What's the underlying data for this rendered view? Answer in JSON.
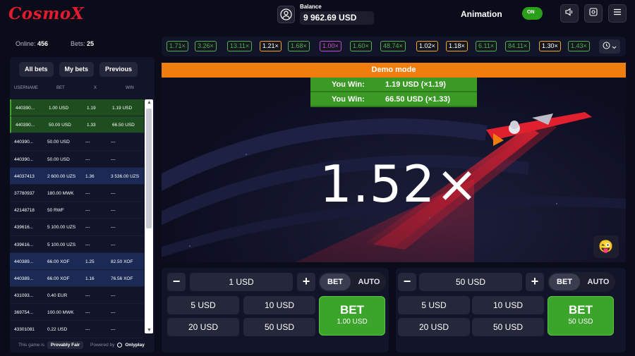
{
  "header": {
    "logo": "CosmoX",
    "balance_label": "Balance",
    "balance_value": "9 962.69 USD",
    "animation_label": "Animation",
    "animation_toggle": "ON",
    "colors": {
      "brand_red": "#e21b2f",
      "toggle_green": "#2aa01a"
    },
    "icons": [
      "user-icon",
      "speaker-icon",
      "settings-icon",
      "menu-icon"
    ]
  },
  "stats": {
    "online_label": "Online:",
    "online_value": "456",
    "bets_label": "Bets:",
    "bets_value": "25"
  },
  "left_tabs": [
    "All bets",
    "My bets",
    "Previous"
  ],
  "table": {
    "headers": [
      "USERNAME",
      "BET",
      "X",
      "WIN"
    ],
    "rows": [
      {
        "user": "440390...",
        "bet": "1.00 USD",
        "x": "1.19",
        "win": "1.19 USD",
        "style": "win"
      },
      {
        "user": "440390...",
        "bet": "50.00 USD",
        "x": "1.33",
        "win": "66.50 USD",
        "style": "win"
      },
      {
        "user": "440390...",
        "bet": "50.00 USD",
        "x": "---",
        "win": "---",
        "style": ""
      },
      {
        "user": "440390...",
        "bet": "50.00 USD",
        "x": "---",
        "win": "---",
        "style": ""
      },
      {
        "user": "44037413",
        "bet": "2 600.00 UZS",
        "x": "1.36",
        "win": "3 536.00 UZS",
        "style": "blue"
      },
      {
        "user": "37780937",
        "bet": "180.00 MWK",
        "x": "---",
        "win": "---",
        "style": ""
      },
      {
        "user": "42148718",
        "bet": "50 RWF",
        "x": "---",
        "win": "---",
        "style": ""
      },
      {
        "user": "439616...",
        "bet": "5 100.00 UZS",
        "x": "---",
        "win": "---",
        "style": ""
      },
      {
        "user": "439616...",
        "bet": "5 100.00 UZS",
        "x": "---",
        "win": "---",
        "style": ""
      },
      {
        "user": "440389...",
        "bet": "66.00 XOF",
        "x": "1.25",
        "win": "82.50 XOF",
        "style": "blue"
      },
      {
        "user": "440389...",
        "bet": "66.00 XOF",
        "x": "1.16",
        "win": "76.56 XOF",
        "style": "blue"
      },
      {
        "user": "431093...",
        "bet": "0.40 EUR",
        "x": "---",
        "win": "---",
        "style": ""
      },
      {
        "user": "369754...",
        "bet": "100.00 MWK",
        "x": "---",
        "win": "---",
        "style": ""
      },
      {
        "user": "43301081",
        "bet": "0.22 USD",
        "x": "---",
        "win": "---",
        "style": ""
      }
    ]
  },
  "footer": {
    "text1": "This game is",
    "provably_fair": "Provably Fair",
    "powered_by": "Powered by",
    "provider": "Onlyplay"
  },
  "multipliers": [
    {
      "value": "1.71×",
      "color": "#4caf50"
    },
    {
      "value": "3.26×",
      "color": "#4caf50"
    },
    {
      "value": "13.11×",
      "color": "#4caf50"
    },
    {
      "value": "1.21×",
      "color": "#f5a623"
    },
    {
      "value": "1.68×",
      "color": "#4caf50"
    },
    {
      "value": "1.00×",
      "color": "#c04ad9"
    },
    {
      "value": "1.60×",
      "color": "#4caf50"
    },
    {
      "value": "48.74×",
      "color": "#4caf50"
    },
    {
      "value": "1.02×",
      "color": "#f5a623"
    },
    {
      "value": "1.18×",
      "color": "#f5a623"
    },
    {
      "value": "6.11×",
      "color": "#4caf50"
    },
    {
      "value": "84.11×",
      "color": "#4caf50"
    },
    {
      "value": "1.30×",
      "color": "#f5a623"
    },
    {
      "value": "1.43×",
      "color": "#4caf50"
    }
  ],
  "game": {
    "demo_mode": "Demo mode",
    "wins": [
      {
        "label": "You Win:",
        "amount": "1.19 USD (×1.19)"
      },
      {
        "label": "You Win:",
        "amount": "66.50 USD (×1.33)"
      }
    ],
    "multiplier": "1.52×",
    "emoji": "😜"
  },
  "bet_panels": [
    {
      "amount": "1 USD",
      "minus": "−",
      "plus": "+",
      "mode_bet": "BET",
      "mode_auto": "AUTO",
      "quick": [
        "5 USD",
        "10 USD",
        "20 USD",
        "50 USD"
      ],
      "bet_label": "BET",
      "bet_amount": "1.00 USD"
    },
    {
      "amount": "50 USD",
      "minus": "−",
      "plus": "+",
      "mode_bet": "BET",
      "mode_auto": "AUTO",
      "quick": [
        "5 USD",
        "10 USD",
        "20 USD",
        "50 USD"
      ],
      "bet_label": "BET",
      "bet_amount": "50 USD"
    }
  ]
}
